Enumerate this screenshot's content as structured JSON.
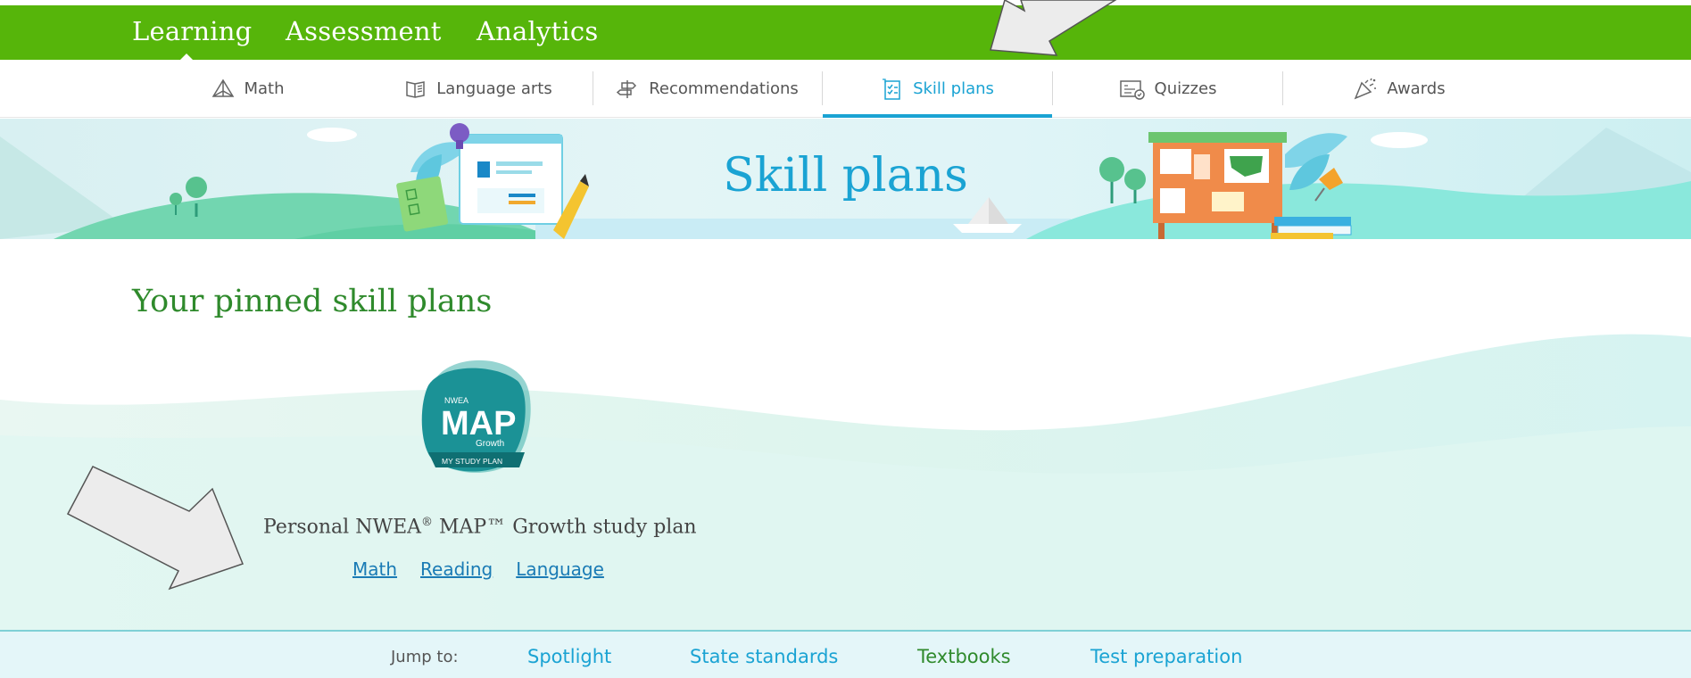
{
  "topnav": {
    "items": [
      "Learning",
      "Assessment",
      "Analytics"
    ],
    "active": "Learning"
  },
  "subnav": {
    "tabs": [
      {
        "label": "Math",
        "icon": "pyramid-icon"
      },
      {
        "label": "Language arts",
        "icon": "book-icon"
      },
      {
        "label": "Recommendations",
        "icon": "signpost-icon"
      },
      {
        "label": "Skill plans",
        "icon": "checklist-icon"
      },
      {
        "label": "Quizzes",
        "icon": "quiz-icon"
      },
      {
        "label": "Awards",
        "icon": "party-popper-icon"
      }
    ],
    "active": "Skill plans"
  },
  "banner": {
    "title": "Skill plans"
  },
  "pinned": {
    "heading": "Your pinned skill plans",
    "badge": {
      "line1": "NWEA",
      "line2": "MAP",
      "line3": "Growth",
      "line4": "MY STUDY PLAN"
    },
    "plan_title_prefix": "Personal NWEA",
    "plan_title_sup": "®",
    "plan_title_suffix": " MAP™ Growth study plan",
    "links": [
      "Math",
      "Reading",
      "Language"
    ]
  },
  "footer": {
    "label": "Jump to:",
    "links": [
      {
        "label": "Spotlight",
        "color": "#1aa3d3"
      },
      {
        "label": "State standards",
        "color": "#1aa3d3"
      },
      {
        "label": "Textbooks",
        "color": "#2f8a2c"
      },
      {
        "label": "Test preparation",
        "color": "#1aa3d3"
      }
    ]
  },
  "colors": {
    "brand_green": "#56b50a",
    "accent_blue": "#1aa3d3",
    "heading_green": "#2f8a2c"
  }
}
